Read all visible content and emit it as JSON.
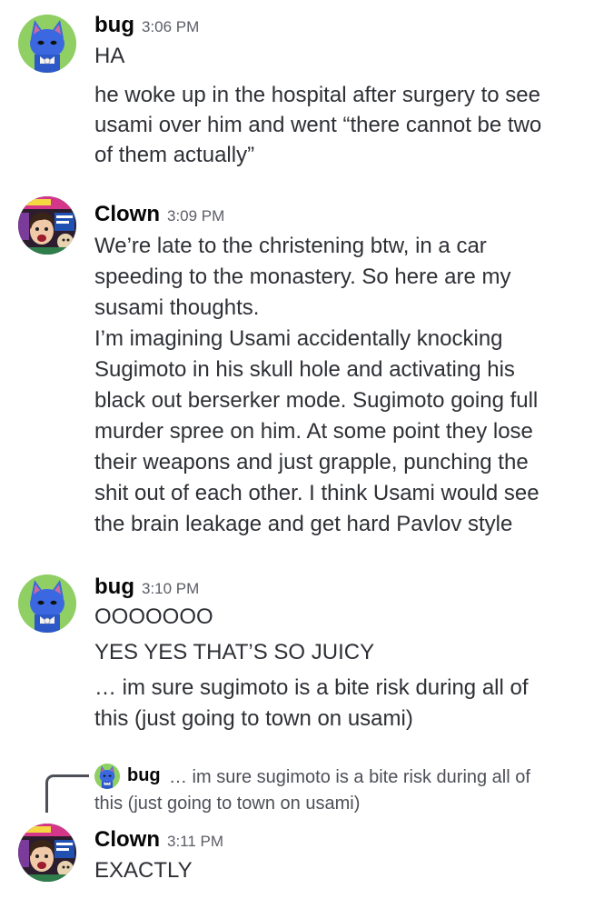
{
  "messages": [
    {
      "author": "bug",
      "time": "3:06 PM",
      "lines": [
        "HA",
        "he woke up in the hospital after surgery to see",
        "usami over him and went “there cannot be two",
        "of them actually”"
      ]
    },
    {
      "author": "Clown",
      "time": "3:09 PM",
      "lines": [
        "We’re late to the christening btw, in a car",
        "speeding to the monastery. So here are my",
        "susami thoughts.",
        "I’m imagining Usami accidentally knocking",
        "Sugimoto in his skull hole and activating his",
        "black out berserker mode. Sugimoto going full",
        "murder spree on him. At some point they lose",
        "their weapons and just grapple, punching the",
        "shit out of each other. I think Usami would see",
        "the brain leakage and get hard Pavlov style"
      ]
    },
    {
      "author": "bug",
      "time": "3:10 PM",
      "lines": [
        "OOOOOOO",
        "YES YES THAT’S SO JUICY",
        "… im sure sugimoto is a bite risk during all of",
        "this (just going to town on usami)"
      ]
    },
    {
      "author": "Clown",
      "time": "3:11 PM",
      "lines": [
        "EXACTLY"
      ]
    }
  ],
  "reply": {
    "author": "bug",
    "lines": [
      "… im sure sugimoto is a bite risk during all of",
      "this (just going to town on usami)"
    ]
  },
  "colors": {
    "author": "#060607",
    "body_text": "#2e3035",
    "timestamp": "#5c5e66",
    "reply_spine": "#4e5058",
    "bug_avatar_bg": "#8fcf63",
    "bug_avatar_figure": "#3b68e0",
    "clown_avatar_bg": "#2b1d2e"
  },
  "icons": {
    "bug_avatar": "blue-cat-avatar",
    "clown_avatar": "collage-avatar"
  }
}
